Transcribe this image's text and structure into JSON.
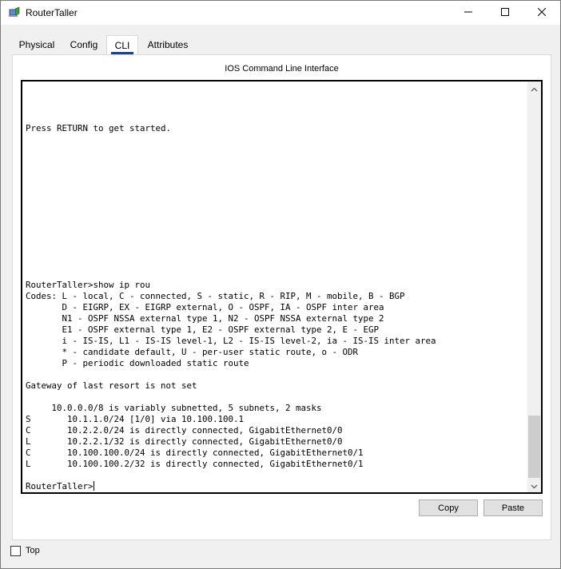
{
  "window": {
    "title": "RouterTaller",
    "icon": "router-laptop-icon",
    "controls": [
      "minimize-icon",
      "maximize-icon",
      "close-icon"
    ]
  },
  "tabs": [
    {
      "label": "Physical",
      "active": false
    },
    {
      "label": "Config",
      "active": false
    },
    {
      "label": "CLI",
      "active": true
    },
    {
      "label": "Attributes",
      "active": false
    }
  ],
  "panel": {
    "title": "IOS Command Line Interface"
  },
  "terminal": {
    "lines": [
      "Press RETURN to get started.",
      "",
      "",
      "",
      "",
      "",
      "",
      "",
      "",
      "",
      "",
      "",
      "",
      "",
      "RouterTaller>show ip rou",
      "Codes: L - local, C - connected, S - static, R - RIP, M - mobile, B - BGP",
      "       D - EIGRP, EX - EIGRP external, O - OSPF, IA - OSPF inter area",
      "       N1 - OSPF NSSA external type 1, N2 - OSPF NSSA external type 2",
      "       E1 - OSPF external type 1, E2 - OSPF external type 2, E - EGP",
      "       i - IS-IS, L1 - IS-IS level-1, L2 - IS-IS level-2, ia - IS-IS inter area",
      "       * - candidate default, U - per-user static route, o - ODR",
      "       P - periodic downloaded static route",
      "",
      "Gateway of last resort is not set",
      "",
      "     10.0.0.0/8 is variably subnetted, 5 subnets, 2 masks",
      "S       10.1.1.0/24 [1/0] via 10.100.100.1",
      "C       10.2.2.0/24 is directly connected, GigabitEthernet0/0",
      "L       10.2.2.1/32 is directly connected, GigabitEthernet0/0",
      "C       10.100.100.0/24 is directly connected, GigabitEthernet0/1",
      "L       10.100.100.2/32 is directly connected, GigabitEthernet0/1",
      ""
    ],
    "prompt": "RouterTaller>"
  },
  "buttons": {
    "copy": "Copy",
    "paste": "Paste"
  },
  "footer": {
    "top_label": "Top",
    "top_checked": false
  }
}
